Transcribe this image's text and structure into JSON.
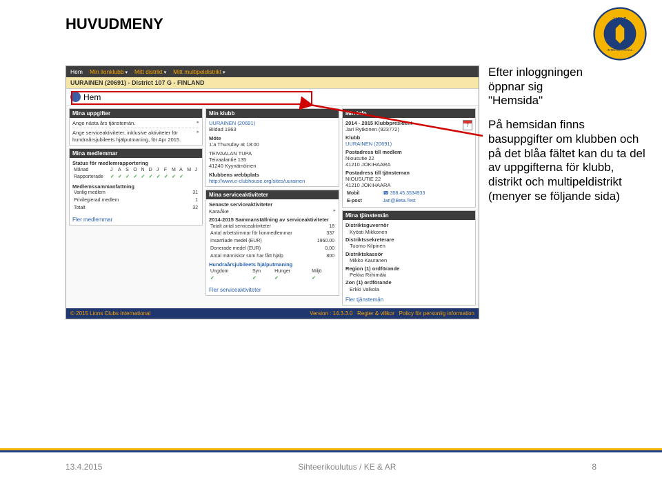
{
  "pageTitle": "HUVUDMENY",
  "side": {
    "p1_l1": "Efter inloggningen",
    "p1_l2": "öppnar sig",
    "p1_l3": "\"Hemsida\"",
    "p2": "På hemsidan finns basuppgifter om klubben och på det blåa fältet kan du ta del av uppgifterna för klubb, distrikt och multipeldistrikt (menyer se följande sida)"
  },
  "nav": {
    "hem": "Hem",
    "klubb": "Min lionklubb",
    "dist": "Mitt distrikt",
    "multi": "Mitt multipeldistrikt"
  },
  "context": "UURAINEN (20691) - District 107 G - FINLAND",
  "hemLabel": "Hem",
  "colA": {
    "uppgifter": {
      "head": "Mina uppgifter",
      "l1": "Ange nästa års tjänstemän.",
      "l2": "Ange serviceaktiviteter, inklusive aktiviteter för hundraårsjubileets hjälputmaning, för Apr 2015."
    },
    "medlemmar": {
      "head": "Mina medlemmar",
      "status": "Status för medlemrapportering",
      "months": [
        "Månad",
        "J",
        "A",
        "S",
        "O",
        "N",
        "D",
        "J",
        "F",
        "M",
        "A",
        "M",
        "J"
      ],
      "rapport": "Rapporterade",
      "summaryHead": "Medlemssammanfattning",
      "vanlig": [
        "Vanlig medlem",
        "31"
      ],
      "priv": [
        "Privilegierad medlem",
        "1"
      ],
      "tot": [
        "Totalt",
        "32"
      ],
      "link": "Fler medlemmar"
    }
  },
  "colB": {
    "minklubb": {
      "head": "Min klubb",
      "name": "UURAINEN (20691)",
      "bildad": "Bildad 1963",
      "mote": "Möte",
      "mtid": "1:a Thursday at 18:00",
      "venue": "TEIVAALAN TUPA",
      "addr1": "Teivaalantie 135",
      "addr2": "41240 Kyynämöinen",
      "webhead": "Klubbens webbplats",
      "weburl": "http://www.e-clubhouse.org/sites/uurainen"
    },
    "service": {
      "head": "Mina serviceaktiviteter",
      "senaste": "Senaste serviceaktiviteter",
      "item1": "KaraÅke",
      "samm": "2014-2015 Sammanställning av serviceaktiviteter",
      "rows": [
        [
          "Totalt antal serviceaktiviteter",
          "18"
        ],
        [
          "Antal arbetstimmar för lionmedlemmar",
          "337"
        ],
        [
          "Insamlade medel (EUR)",
          "1960.00"
        ],
        [
          "Donerade medel (EUR)",
          "0.00"
        ],
        [
          "Antal människor som har fått hjälp",
          "800"
        ]
      ],
      "hjalp": "Hundraårsjubileets hjälputmaning",
      "cats": [
        "Ungdom",
        "Syn",
        "Hunger",
        "Miljö"
      ],
      "link": "Fler serviceaktiviteter"
    }
  },
  "colC": {
    "info": {
      "head": "Min info",
      "lPres": "2014 - 2015 Klubbpresident",
      "vPres": "Jari Rytkönen (923772)",
      "lKlubb": "Klubb",
      "vKlubb": "UURAINEN (20691)",
      "pMed": "Postadress till medlem",
      "pMed1": "Niousutie 22",
      "pMed2": "41210 JOKIHAARA",
      "pTj": "Postadress till tjänsteman",
      "pTj1": "NIOUSUTIE 22",
      "pTj2": "41210 JOKIHAARA",
      "mobil": "Mobil",
      "mobilV": "☎ 358.45.3534933",
      "epost": "E-post",
      "epostV": "Jari@Beta.Test"
    },
    "tjman": {
      "head": "Mina tjänstemän",
      "rows": [
        [
          "Distriktsguvernör",
          "Kyösti Mikkonen"
        ],
        [
          "Distriktssekreterare",
          "Tuomo Kilpinen"
        ],
        [
          "Distriktskassör",
          "Mikko Kauranen"
        ],
        [
          "Region (1) ordförande",
          "Pekka Riihimäki"
        ],
        [
          "Zon (1) ordförande",
          "Erkki Valkola"
        ]
      ],
      "link": "Fler tjänstemän"
    }
  },
  "bfooter": {
    "copy": "© 2015 Lions Clubs International",
    "ver": "Version : 14.3.3.0",
    "regler": "Regler & villkor",
    "policy": "Policy för personlig information"
  },
  "footer": {
    "date": "13.4.2015",
    "center": "Sihteerikoulutus / KE & AR",
    "page": "8"
  }
}
